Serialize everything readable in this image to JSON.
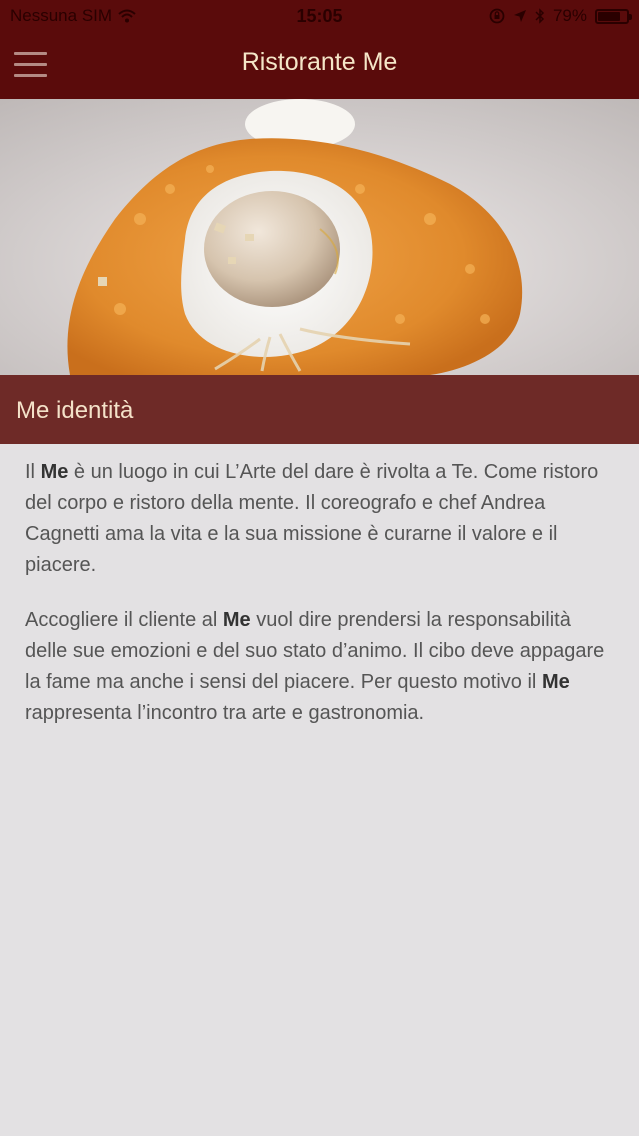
{
  "status_bar": {
    "carrier": "Nessuna SIM",
    "time": "15:05",
    "battery": "79%",
    "battery_level": 0.79
  },
  "navbar": {
    "title": "Ristorante Me",
    "menu_icon": "hamburger-menu-icon"
  },
  "hero_image": {
    "description": "risotto-dish-photo"
  },
  "section": {
    "title": "Me identità"
  },
  "content": {
    "p1": {
      "t1": "Il ",
      "b1": "Me",
      "t2": " è un luogo in cui L’Arte del dare è rivolta a Te. Come ristoro del corpo e ristoro della mente. Il coreografo e chef Andrea Cagnetti ama la vita e la sua missione è curarne il valore e il piacere."
    },
    "p2": {
      "t1": "Accogliere il cliente al ",
      "b1": "Me",
      "t2": " vuol dire prendersi la responsabilità delle sue emozioni e del suo stato d’animo. Il cibo deve appagare la fame ma anche i sensi del piacere. Per questo motivo il ",
      "b2": "Me",
      "t3": " rappresenta l’incontro tra arte e gastronomia."
    }
  },
  "colors": {
    "navbar": "#5a0b0b",
    "section_header": "#6e2a27",
    "background": "#e3e1e3",
    "title_text": "#f5e6c8"
  }
}
